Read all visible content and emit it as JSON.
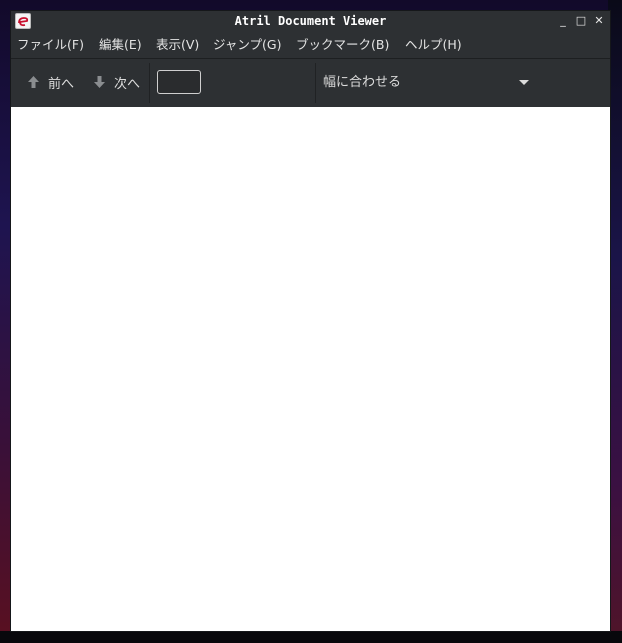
{
  "window": {
    "title": "Atril Document Viewer",
    "minimize_glyph": "_",
    "maximize_glyph": "□",
    "close_glyph": "✕",
    "icon": "atril-app-icon"
  },
  "menubar": {
    "items": [
      {
        "label": "ファイル(F)"
      },
      {
        "label": "編集(E)"
      },
      {
        "label": "表示(V)"
      },
      {
        "label": "ジャンプ(G)"
      },
      {
        "label": "ブックマーク(B)"
      },
      {
        "label": "ヘルプ(H)"
      }
    ]
  },
  "toolbar": {
    "prev_label": "前へ",
    "prev_icon": "arrow-up-icon",
    "next_label": "次へ",
    "next_icon": "arrow-down-icon",
    "page_value": "",
    "zoom_selected": "幅に合わせる"
  },
  "colors": {
    "window_bg": "#2d3033",
    "text": "#e4e4e4",
    "document_bg": "#ffffff"
  }
}
